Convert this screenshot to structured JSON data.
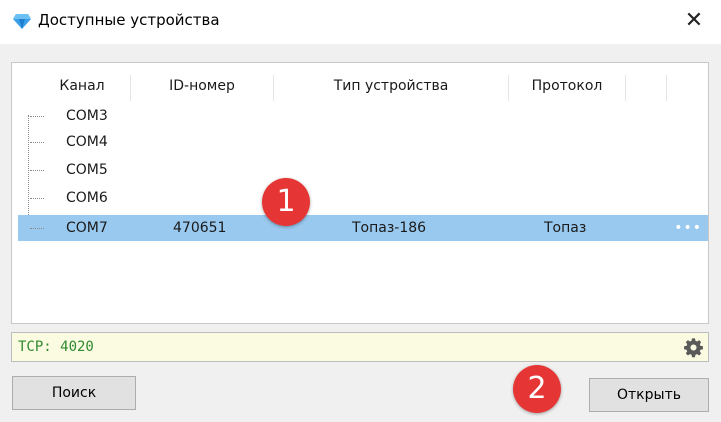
{
  "window": {
    "title": "Доступные устройства",
    "close_label": "✕"
  },
  "table": {
    "columns": [
      "Канал",
      "ID-номер",
      "Тип устройства",
      "Протокол"
    ],
    "rows": [
      {
        "channel": "COM3",
        "id": "",
        "type": "",
        "protocol": ""
      },
      {
        "channel": "COM4",
        "id": "",
        "type": "",
        "protocol": ""
      },
      {
        "channel": "COM5",
        "id": "",
        "type": "",
        "protocol": ""
      },
      {
        "channel": "COM6",
        "id": "",
        "type": "",
        "protocol": ""
      },
      {
        "channel": "COM7",
        "id": "470651",
        "type": "Топаз-186",
        "protocol": "Топаз",
        "selected": true,
        "more": "•••"
      }
    ]
  },
  "tcp": {
    "label": "TCP: 4020"
  },
  "buttons": {
    "search": "Поиск",
    "open": "Открыть"
  },
  "badges": {
    "one": "1",
    "two": "2"
  },
  "colors": {
    "selection": "#99c9ef",
    "badge": "#e53535",
    "tcp_text": "#2f8a2f",
    "tcp_bg": "#fbfbe2"
  },
  "icons": {
    "title": "diamond-icon",
    "settings": "gear-icon",
    "more": "ellipsis-icon"
  }
}
